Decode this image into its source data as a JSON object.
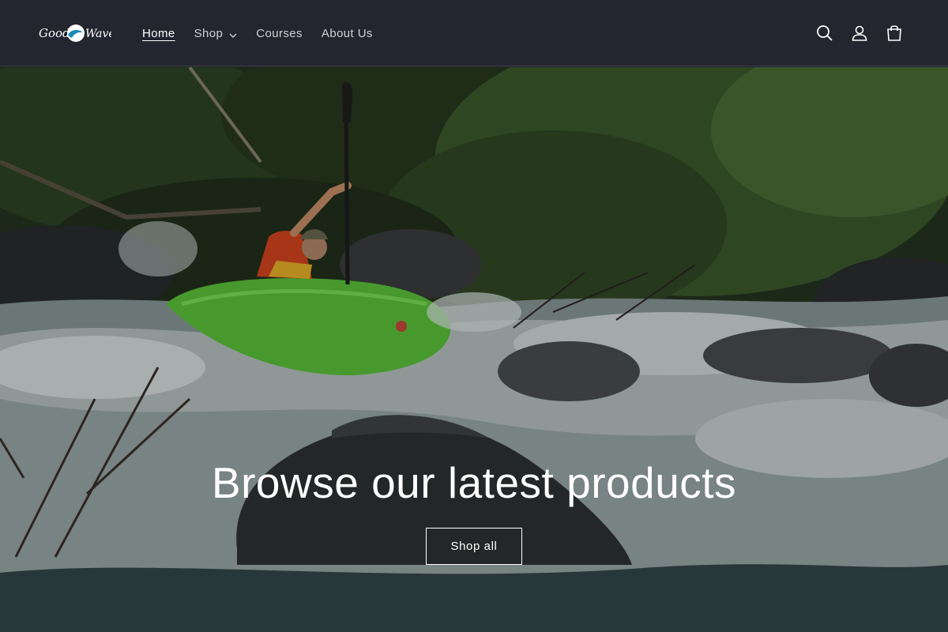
{
  "brand": {
    "logo_text": "GoodWave"
  },
  "nav": {
    "items": [
      {
        "label": "Home",
        "active": true
      },
      {
        "label": "Shop",
        "has_dropdown": true
      },
      {
        "label": "Courses"
      },
      {
        "label": "About Us"
      }
    ]
  },
  "header_icons": [
    "search-icon",
    "account-icon",
    "cart-icon"
  ],
  "hero": {
    "heading": "Browse our latest products",
    "button_label": "Shop all",
    "image_subject": "kayaker in green kayak on whitewater rapids"
  },
  "colors": {
    "header_bg": "#23252f",
    "text_light": "#ffffff",
    "nav_text": "#cfd1d8",
    "kayak_green": "#58c23a"
  }
}
